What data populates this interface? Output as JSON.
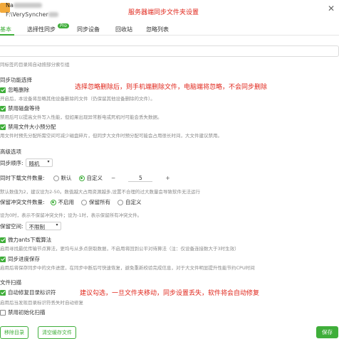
{
  "header": {
    "name_prefix": "Na",
    "path_prefix": "F:\\VerySyncher",
    "server_annotation": "服务器端同步文件夹设置",
    "close_icon": "close-icon"
  },
  "tabs": [
    {
      "label": "基本",
      "active": true
    },
    {
      "label": "选择性同步",
      "badge": "Pro"
    },
    {
      "label": "同步设备"
    },
    {
      "label": "回收站"
    },
    {
      "label": "忽略列表"
    }
  ],
  "ignore_hint": "同标签的目录将自动按部分索引组",
  "sync_options": {
    "title": "同步功能选择",
    "ignore_delete": {
      "label": "忽略删除",
      "checked": true,
      "hint": "开启后，本设备将忽略其他设备删除的文件（仍保留其他设备删除的文件）。"
    },
    "annotation": "选择忽略删除后，则手机端删除文件，电脑端将忽略，不会同步删除",
    "disable_disk_wait": {
      "label": "禁用磁盘等待",
      "checked": true,
      "hint": "禁用后可以提高文件写入性能，但如果出现异常断电或死机时可能会丢失数据。"
    },
    "disable_prealloc": {
      "label": "禁用文件大小预分配",
      "checked": true,
      "hint": "用文件时预先分配所需空间可减少磁盘碎片，但同步大文件时预分配可能会占用很长时间，大文件建议禁用。"
    }
  },
  "advanced": {
    "title": "高级选项",
    "sync_order_label": "同步顺序:",
    "sync_order_value": "随机",
    "concurrent_label": "同时下载文件数量:",
    "concurrent_default": "默认",
    "concurrent_custom": "自定义",
    "concurrent_minus": "−",
    "concurrent_value": "5",
    "concurrent_plus": "+",
    "concurrent_hint": "默认数值为2，建议设为2-50。数值越大占用资源越多,设置不合理的过大数量会导致软件无法运行",
    "conflict_label": "保留冲突文件数量:",
    "conflict_none": "不启用",
    "conflict_all": "保留所有",
    "conflict_custom": "自定义",
    "conflict_hint": "设为0时，表示不保留冲突文件；设为-1时，表示保留所有冲突文件。",
    "keep_space_label": "保留空间:",
    "keep_space_value": "不限制",
    "micro_ants": {
      "label": "微力ants下载算法",
      "checked": true,
      "hint": "启用寻找最优传输节点算法，更均与从多点获取数据，不启用将回到公平对待算法（注：仅设备连接数大于3时生效）"
    },
    "sync_progress": {
      "label": "同步进度保存",
      "checked": true,
      "hint": "启用后将保存同步中的文件进度，在同步中断后可快速恢复，避免重新校验完成信息，对于大文件明显提升性能节约CPU时间"
    }
  },
  "file_scan": {
    "title": "文件扫描",
    "auto_repair": {
      "label": "自动修复目录标识符",
      "checked": true,
      "hint": "启用后当发现目录标识符丢失时自动修复"
    },
    "annotation": "建议勾选，一旦文件夹移动，同步设置丢失，软件将会自动修复",
    "disable_init_scan": {
      "label": "禁用初始化扫描",
      "checked": false
    }
  },
  "footer": {
    "remove_dir": "移除目录",
    "clear_cache": "清空缓存文件",
    "save": "保存"
  },
  "colors": {
    "accent": "#3fae3a",
    "annotation_red": "#e0261b"
  }
}
